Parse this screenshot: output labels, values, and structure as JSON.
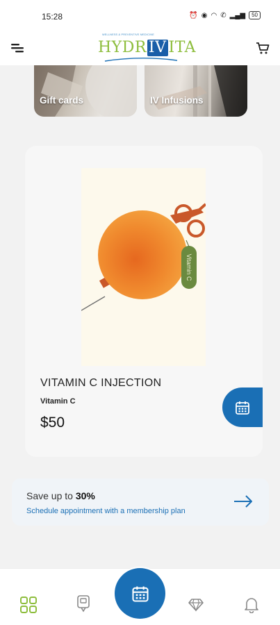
{
  "status_bar": {
    "time": "15:28",
    "battery": "50"
  },
  "header": {
    "logo": {
      "tagline": "WELLNESS & PREVENTIVE MEDICINE",
      "word_left": "HYDR",
      "word_mid": "IV",
      "word_right": "ITA"
    },
    "menu_icon": "menu-icon",
    "cart_icon": "cart-icon"
  },
  "categories": [
    {
      "label": "Gift cards"
    },
    {
      "label": "IV Infusions"
    }
  ],
  "product": {
    "tag_text": "Vitamin C",
    "title": "VITAMIN C INJECTION",
    "subtitle": "Vitamin C",
    "price": "$50",
    "book_icon": "calendar-icon"
  },
  "promo": {
    "prefix": "Save up to ",
    "highlight": "30%",
    "link_text": "Schedule appointment with a membership plan",
    "arrow_icon": "arrow-right-icon"
  },
  "bottom_nav": {
    "items": [
      "home-grid-icon",
      "treatments-icon",
      "calendar-icon",
      "diamond-icon",
      "bell-icon"
    ],
    "active_color": "#8dbd3c"
  },
  "colors": {
    "primary": "#1a6fb5",
    "brand_green": "#8dbd3c",
    "background": "#f2f2f2"
  }
}
